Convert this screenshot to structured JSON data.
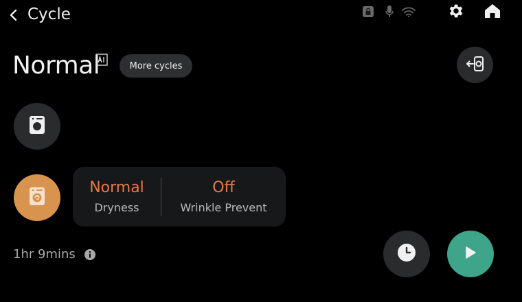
{
  "header": {
    "title": "Cycle",
    "icons": [
      "back-arrow-icon",
      "lock-icon",
      "microphone-icon",
      "wifi-icon",
      "gear-icon",
      "home-icon"
    ]
  },
  "cycle": {
    "name": "Normal",
    "ai_badge_icon": "ai-badge-icon",
    "more_cycles_label": "More cycles",
    "link_icon": "smart-control-icon"
  },
  "device": {
    "icon": "dryer-icon"
  },
  "options": {
    "icon": "dryer-options-icon",
    "accent_color": "#e8774a",
    "dryness": {
      "value": "Normal",
      "label": "Dryness"
    },
    "wrinkle": {
      "value": "Off",
      "label": "Wrinkle Prevent"
    }
  },
  "status": {
    "remaining_time": "1hr 9mins",
    "info_icon": "info-icon"
  },
  "actions": {
    "delay_icon": "clock-icon",
    "start_icon": "play-icon",
    "start_color": "#3ea58a",
    "options_color": "#d8944f"
  }
}
